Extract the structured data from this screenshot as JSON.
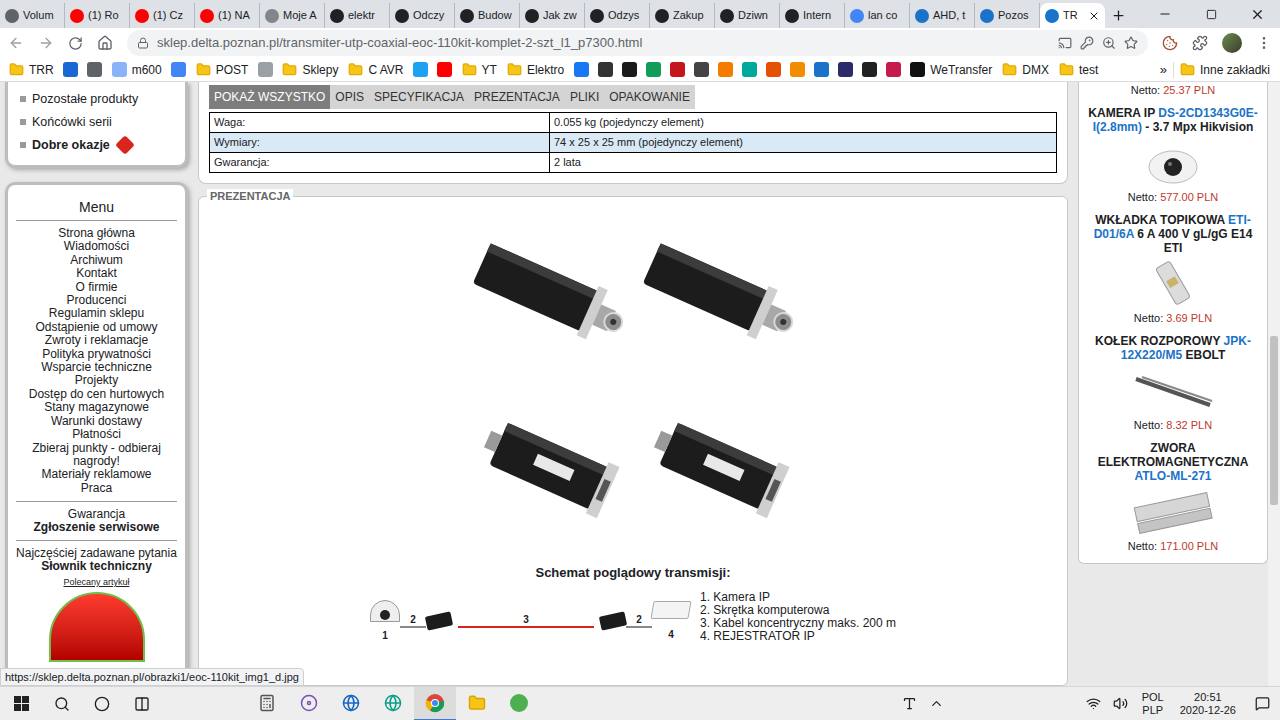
{
  "browser": {
    "tabs": [
      {
        "label": "Volum",
        "selected": false,
        "color": "#5f6368"
      },
      {
        "label": "(1) Ro",
        "selected": false,
        "color": "#ff0000"
      },
      {
        "label": "(1) Cz",
        "selected": false,
        "color": "#ff0000"
      },
      {
        "label": "(1) NA",
        "selected": false,
        "color": "#ff0000"
      },
      {
        "label": "Moje A",
        "selected": false,
        "color": "#80868b"
      },
      {
        "label": "elektr",
        "selected": false,
        "color": "#202124"
      },
      {
        "label": "Odczy",
        "selected": false,
        "color": "#202124"
      },
      {
        "label": "Budow",
        "selected": false,
        "color": "#202124"
      },
      {
        "label": "Jak zw",
        "selected": false,
        "color": "#202124"
      },
      {
        "label": "Odzys",
        "selected": false,
        "color": "#202124"
      },
      {
        "label": "Zakup",
        "selected": false,
        "color": "#202124"
      },
      {
        "label": "Dziwn",
        "selected": false,
        "color": "#202124"
      },
      {
        "label": "Intern",
        "selected": false,
        "color": "#202124"
      },
      {
        "label": "lan co",
        "selected": false,
        "color": "#4285f4"
      },
      {
        "label": "AHD, t",
        "selected": false,
        "color": "#1a73c8"
      },
      {
        "label": "Pozos",
        "selected": false,
        "color": "#1a73c8"
      },
      {
        "label": "TR",
        "selected": true,
        "color": "#1a73c8"
      }
    ],
    "url": "sklep.delta.poznan.pl/transmiter-utp-coaxial-eoc-110kit-komplet-2-szt_l1_p7300.html",
    "bookmarks": [
      {
        "kind": "folder",
        "label": "TRR"
      },
      {
        "kind": "icon",
        "color": "#1967d2"
      },
      {
        "kind": "icon",
        "color": "#5f6368"
      },
      {
        "kind": "link",
        "label": "m600",
        "color": "#8ab4f8"
      },
      {
        "kind": "icon",
        "color": "#4285f4"
      },
      {
        "kind": "folder",
        "label": "POST"
      },
      {
        "kind": "icon",
        "color": "#9aa0a6"
      },
      {
        "kind": "folder",
        "label": "Sklepy"
      },
      {
        "kind": "folder",
        "label": "C AVR"
      },
      {
        "kind": "icon",
        "color": "#1da1f2"
      },
      {
        "kind": "icon",
        "color": "#ff0000"
      },
      {
        "kind": "folder",
        "label": "YT"
      },
      {
        "kind": "folder",
        "label": "Elektro"
      },
      {
        "kind": "icon",
        "color": "#1877f2"
      },
      {
        "kind": "icon",
        "color": "#333333"
      },
      {
        "kind": "icon",
        "color": "#1b1b1b"
      },
      {
        "kind": "icon",
        "color": "#0f9d58"
      },
      {
        "kind": "icon",
        "color": "#c4161c"
      },
      {
        "kind": "icon",
        "color": "#444444"
      },
      {
        "kind": "icon",
        "color": "#f57c00"
      },
      {
        "kind": "icon",
        "color": "#00a99d"
      },
      {
        "kind": "icon",
        "color": "#e65100"
      },
      {
        "kind": "icon",
        "color": "#f28c00"
      },
      {
        "kind": "icon",
        "color": "#1a73c8"
      },
      {
        "kind": "icon",
        "color": "#2b2b6b"
      },
      {
        "kind": "icon",
        "color": "#222222"
      },
      {
        "kind": "icon",
        "color": "#c51a4a"
      },
      {
        "kind": "link",
        "label": "WeTransfer",
        "color": "#111111"
      },
      {
        "kind": "folder",
        "label": "DMX"
      },
      {
        "kind": "folder",
        "label": "test"
      }
    ],
    "bookmarks_more": "»",
    "other_bookmarks": "Inne zakładki",
    "status_url": "https://sklep.delta.poznan.pl/obrazki1/eoc-110kit_img1_d.jpg"
  },
  "sidebar": {
    "top_items": [
      {
        "label": "Pozostałe produkty",
        "highlighted": false,
        "badge": false
      },
      {
        "label": "Końcówki serii",
        "highlighted": false,
        "badge": false
      },
      {
        "label": "Dobre okazje",
        "highlighted": true,
        "badge": true
      }
    ],
    "menu_title": "Menu",
    "menu_items": [
      "Strona główna",
      "Wiadomości",
      "Archiwum",
      "Kontakt",
      "O firmie",
      "Producenci",
      "Regulamin sklepu",
      "Odstąpienie od umowy",
      "Zwroty i reklamacje",
      "Polityka prywatności",
      "Wsparcie techniczne",
      "Projekty",
      "Dostęp do cen hurtowych",
      "Stany magazynowe",
      "Warunki dostawy",
      "Płatności",
      "Zbieraj punkty - odbieraj nagrody!",
      "Materiały reklamowe",
      "Praca"
    ],
    "service_items": [
      {
        "label": "Gwarancja",
        "highlighted": false
      },
      {
        "label": "Zgłoszenie serwisowe",
        "highlighted": true
      }
    ],
    "help_items": [
      {
        "label": "Najczęściej zadawane pytania",
        "highlighted": false
      },
      {
        "label": "Słownik techniczny",
        "highlighted": true
      }
    ],
    "featured_label": "Polecany artykuł"
  },
  "product": {
    "nav": [
      {
        "label": "POKAŻ WSZYSTKO",
        "selected": true
      },
      {
        "label": "OPIS",
        "selected": false
      },
      {
        "label": "SPECYFIKACJA",
        "selected": false
      },
      {
        "label": "PREZENTACJA",
        "selected": false
      },
      {
        "label": "PLIKI",
        "selected": false
      },
      {
        "label": "OPAKOWANIE",
        "selected": false
      }
    ],
    "specs": [
      {
        "label": "Waga:",
        "value": "0.055 kg (pojedynczy element)"
      },
      {
        "label": "Wymiary:",
        "value": "74 x 25 x 25 mm (pojedynczy element)"
      },
      {
        "label": "Gwarancja:",
        "value": "2 lata"
      }
    ],
    "section_title": "PREZENTACJA",
    "schematic": {
      "title": "Schemat poglądowy transmisji:",
      "labels": {
        "camera": "1",
        "patch_left": "2",
        "coax": "3",
        "patch_right": "2",
        "recorder": "4"
      },
      "legend": [
        "1. Kamera IP",
        "2. Skrętka komputerowa",
        "3. Kabel koncentryczny maks. 200 m",
        "4. REJESTRATOR IP"
      ]
    }
  },
  "recommended": {
    "cut_item": {
      "price_label": "Netto:",
      "price": "25.37 PLN"
    },
    "products": [
      {
        "prefix": "KAMERA IP ",
        "model": "DS-2CD1343G0E-I(2.8mm)",
        "suffix": " - 3.7 Mpx Hikvision",
        "price_label": "Netto:",
        "price": "577.00 PLN",
        "kind": "camera"
      },
      {
        "prefix": "WKŁADKA TOPIKOWA ",
        "model": "ETI-D01/6A",
        "suffix": " 6 A 400 V gL/gG E14 ETI",
        "price_label": "Netto:",
        "price": "3.69 PLN",
        "kind": "fuse"
      },
      {
        "prefix": "KOŁEK ROZPOROWY ",
        "model": "JPK-12X220/M5",
        "suffix": " EBOLT",
        "price_label": "Netto:",
        "price": "8.32 PLN",
        "kind": "anchor"
      },
      {
        "prefix": "ZWORA ELEKTROMAGNETYCZNA ",
        "model": "ATLO-ML-271",
        "suffix": "",
        "price_label": "Netto:",
        "price": "171.00 PLN",
        "kind": "maglock"
      }
    ]
  },
  "scrollbar": {
    "position": 0.42,
    "size": 0.28
  },
  "taskbar": {
    "apps": [
      {
        "kind": "calculator",
        "active": false
      },
      {
        "kind": "disc",
        "active": false
      },
      {
        "kind": "edge-legacy",
        "active": false
      },
      {
        "kind": "edge",
        "active": false
      },
      {
        "kind": "chrome",
        "active": true
      },
      {
        "kind": "explorer",
        "active": false
      },
      {
        "kind": "torrent",
        "active": false
      }
    ],
    "language": [
      "POL",
      "PLP"
    ],
    "time": "20:51",
    "date": "2020-12-26"
  }
}
